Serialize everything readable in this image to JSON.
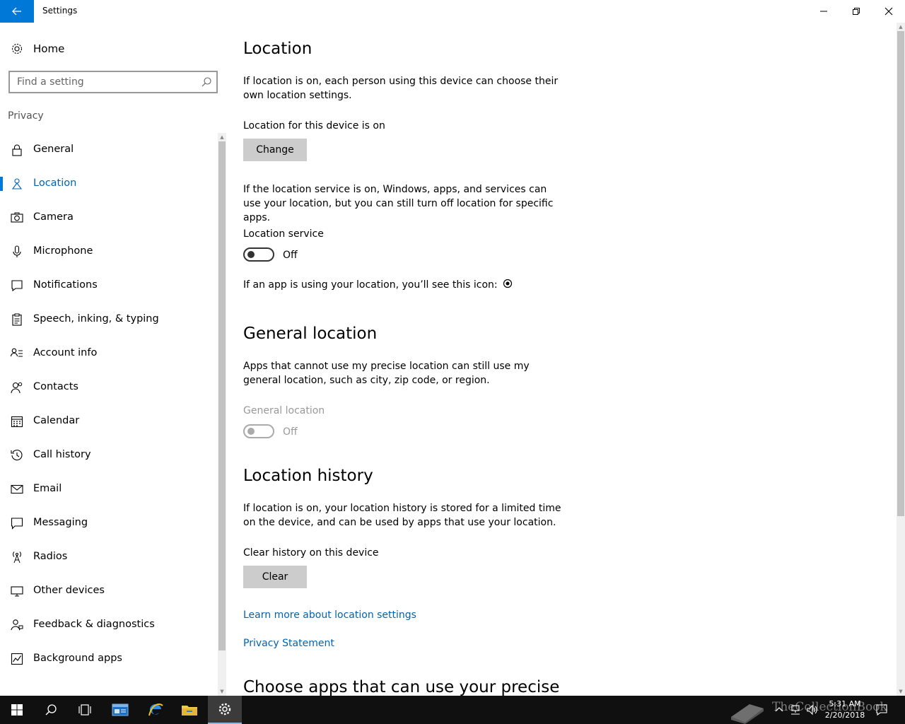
{
  "window": {
    "title": "Settings"
  },
  "sidebar": {
    "home_label": "Home",
    "search_placeholder": "Find a setting",
    "section_label": "Privacy",
    "items": [
      {
        "label": "General",
        "icon": "lock-icon"
      },
      {
        "label": "Location",
        "icon": "location-icon",
        "active": true
      },
      {
        "label": "Camera",
        "icon": "camera-icon"
      },
      {
        "label": "Microphone",
        "icon": "microphone-icon"
      },
      {
        "label": "Notifications",
        "icon": "notifications-icon"
      },
      {
        "label": "Speech, inking, & typing",
        "icon": "clipboard-icon"
      },
      {
        "label": "Account info",
        "icon": "account-info-icon"
      },
      {
        "label": "Contacts",
        "icon": "contacts-icon"
      },
      {
        "label": "Calendar",
        "icon": "calendar-icon"
      },
      {
        "label": "Call history",
        "icon": "history-icon"
      },
      {
        "label": "Email",
        "icon": "email-icon"
      },
      {
        "label": "Messaging",
        "icon": "messaging-icon"
      },
      {
        "label": "Radios",
        "icon": "radio-tower-icon"
      },
      {
        "label": "Other devices",
        "icon": "devices-icon"
      },
      {
        "label": "Feedback & diagnostics",
        "icon": "feedback-icon"
      },
      {
        "label": "Background apps",
        "icon": "background-apps-icon"
      }
    ]
  },
  "main": {
    "location": {
      "heading": "Location",
      "intro": "If location is on, each person using this device can choose their own location settings.",
      "device_status": "Location for this device is on",
      "change_button": "Change",
      "service_desc": "If the location service is on, Windows, apps, and services can use your location, but you can still turn off location for specific apps.",
      "service_label": "Location service",
      "service_state": "Off",
      "icon_note": "If an app is using your location, you’ll see this icon:"
    },
    "general_location": {
      "heading": "General location",
      "desc": "Apps that cannot use my precise location can still use my general location, such as city, zip code, or region.",
      "toggle_label": "General location",
      "toggle_state": "Off"
    },
    "location_history": {
      "heading": "Location history",
      "desc": "If location is on, your location history is stored for a limited time on the device, and can be used by apps that use your location.",
      "clear_label": "Clear history on this device",
      "clear_button": "Clear"
    },
    "links": {
      "learn_more": "Learn more about location settings",
      "privacy_statement": "Privacy Statement"
    },
    "next_heading": "Choose apps that can use your precise"
  },
  "taskbar": {
    "items": [
      "start-icon",
      "search-icon",
      "task-view-icon",
      "app-window-icon",
      "edge-icon",
      "file-explorer-icon",
      "settings-icon"
    ],
    "active_item": "settings-icon",
    "clock_time": "5:31 AM",
    "clock_date": "2/20/2018",
    "watermark_text": "TheCollectionBook"
  },
  "colors": {
    "accent": "#0078d7",
    "link": "#0063b1",
    "taskbar": "#101010"
  }
}
